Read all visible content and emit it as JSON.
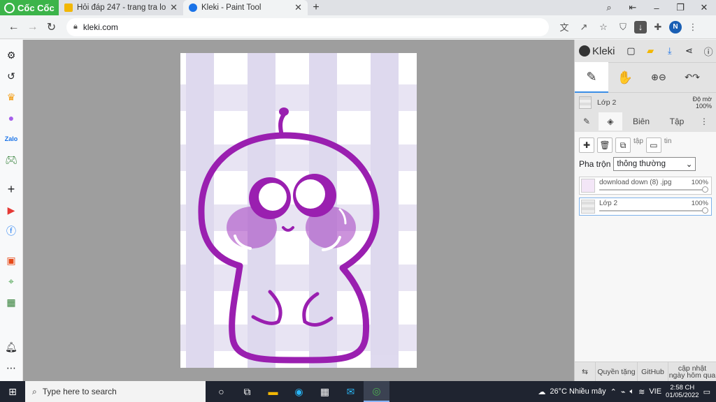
{
  "browser": {
    "brand": "Cốc Cốc",
    "tabs": [
      {
        "title": "Hỏi đáp 247 - trang tra loi",
        "active": false,
        "favicon_color": "#f2b705"
      },
      {
        "title": "Kleki - Paint Tool",
        "active": true,
        "favicon_color": "#1a73e8"
      }
    ],
    "url": "kleki.com"
  },
  "kleki": {
    "logo": "Kleki",
    "layer_current": "Lớp 2",
    "opacity_label": "Độ mờ",
    "opacity_value": "100%",
    "panel_tabs": [
      "Biên",
      "Tập"
    ],
    "layer_btn_labels": {
      "duplicate": "tập",
      "info": "tin"
    },
    "blend_label": "Pha trộn",
    "blend_value": "thông thường",
    "layers": [
      {
        "name": "download down (8) .jpg",
        "opacity": "100%"
      },
      {
        "name": "Lớp 2",
        "opacity": "100%"
      }
    ],
    "footer": {
      "swap": "⇆",
      "privacy": "Quyền tặng",
      "github": "GitHub",
      "updated": "cập nhật",
      "updated_sub": "ngày hôm qua"
    }
  },
  "taskbar": {
    "search_placeholder": "Type here to search",
    "weather": "26°C  Nhiều mây",
    "lang": "VIE",
    "time": "2:58 CH",
    "date": "01/05/2022"
  },
  "colors": {
    "accent": "#1a73e8",
    "drawing": "#9a1fb0",
    "check": "#d9d3ec"
  }
}
